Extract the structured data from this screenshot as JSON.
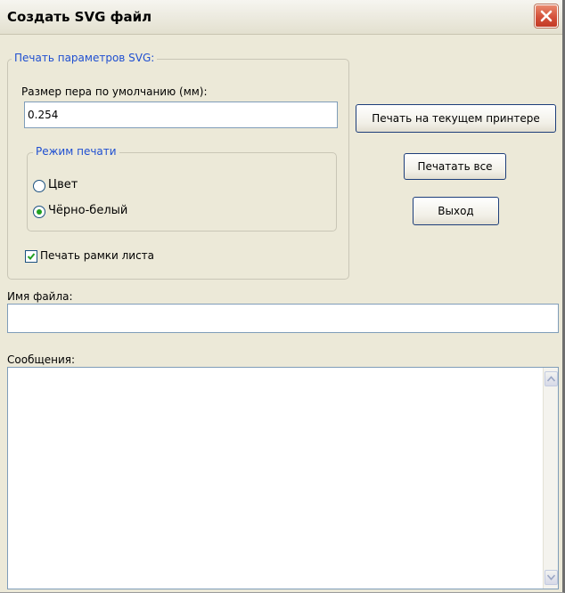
{
  "window": {
    "title": "Создать SVG файл",
    "close_icon": "close-icon"
  },
  "svg_params": {
    "group_title": "Печать параметров SVG:",
    "pen_size_label": "Размер пера по умолчанию (мм):",
    "pen_size_value": "0.254",
    "print_mode": {
      "group_title": "Режим печати",
      "options": [
        {
          "label": "Цвет",
          "selected": false
        },
        {
          "label": "Чёрно-белый",
          "selected": true
        }
      ]
    },
    "print_frame": {
      "label": "Печать рамки листа",
      "checked": true
    }
  },
  "buttons": {
    "print_current": "Печать на текущем принтере",
    "print_all": "Печатать все",
    "exit": "Выход"
  },
  "file": {
    "label": "Имя файла:",
    "value": ""
  },
  "messages": {
    "label": "Сообщения:",
    "text": ""
  },
  "colors": {
    "dialog_bg": "#ece9d8",
    "group_title": "#1f4fd1",
    "close_button": "#d4513a",
    "input_border": "#7f9db9",
    "radio_dot": "#21a121"
  }
}
